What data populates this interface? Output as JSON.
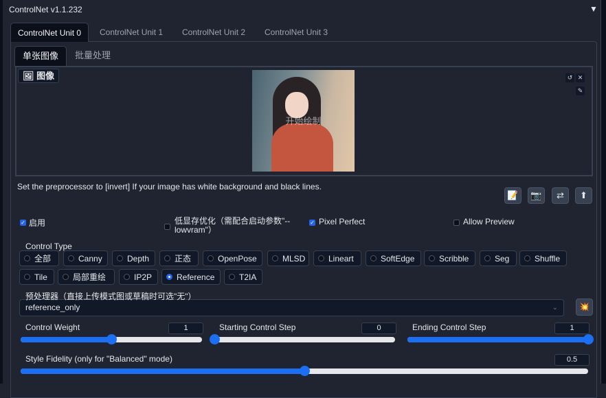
{
  "header": {
    "title": "ControlNet v1.1.232",
    "collapse_icon": "▼"
  },
  "unit_tabs": [
    "ControlNet Unit 0",
    "ControlNet Unit 1",
    "ControlNet Unit 2",
    "ControlNet Unit 3"
  ],
  "mode_tabs": [
    "单张图像",
    "批量处理"
  ],
  "image": {
    "label": "图像",
    "overlay_text": "开始绘制"
  },
  "hint": "Set the preprocessor to [invert] If your image has white background and black lines.",
  "checkboxes": [
    {
      "label": "启用",
      "checked": true
    },
    {
      "label": "低显存优化（需配合启动参数\"--lowvram\"）",
      "checked": false
    },
    {
      "label": "Pixel Perfect",
      "checked": true
    },
    {
      "label": "Allow Preview",
      "checked": false
    }
  ],
  "control_type": {
    "label": "Control Type",
    "selected": "Reference",
    "options": [
      "全部",
      "Canny",
      "Depth",
      "正态",
      "OpenPose",
      "MLSD",
      "Lineart",
      "SoftEdge",
      "Scribble",
      "Seg",
      "Shuffle",
      "Tile",
      "局部重绘",
      "IP2P",
      "Reference",
      "T2IA"
    ]
  },
  "preprocessor": {
    "label": "预处理器（直接上传模式图或草稿时可选\"无\"）",
    "value": "reference_only"
  },
  "sliders": [
    {
      "label": "Control Weight",
      "value": "1",
      "fraction": 0.5
    },
    {
      "label": "Starting Control Step",
      "value": "0",
      "fraction": 0
    },
    {
      "label": "Ending Control Step",
      "value": "1",
      "fraction": 1
    },
    {
      "label": "Style Fidelity (only for \"Balanced\" mode)",
      "value": "0.5",
      "fraction": 0.5
    }
  ]
}
